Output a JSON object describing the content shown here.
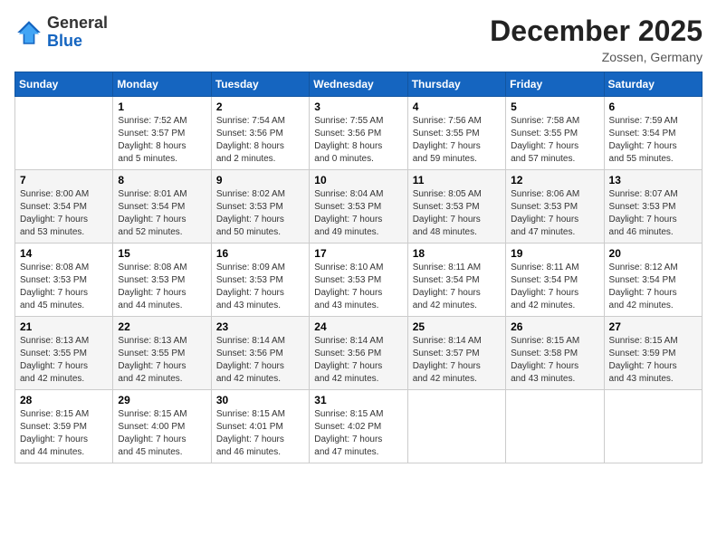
{
  "logo": {
    "general": "General",
    "blue": "Blue"
  },
  "header": {
    "month": "December 2025",
    "location": "Zossen, Germany"
  },
  "weekdays": [
    "Sunday",
    "Monday",
    "Tuesday",
    "Wednesday",
    "Thursday",
    "Friday",
    "Saturday"
  ],
  "weeks": [
    [
      {
        "day": "",
        "info": ""
      },
      {
        "day": "1",
        "info": "Sunrise: 7:52 AM\nSunset: 3:57 PM\nDaylight: 8 hours\nand 5 minutes."
      },
      {
        "day": "2",
        "info": "Sunrise: 7:54 AM\nSunset: 3:56 PM\nDaylight: 8 hours\nand 2 minutes."
      },
      {
        "day": "3",
        "info": "Sunrise: 7:55 AM\nSunset: 3:56 PM\nDaylight: 8 hours\nand 0 minutes."
      },
      {
        "day": "4",
        "info": "Sunrise: 7:56 AM\nSunset: 3:55 PM\nDaylight: 7 hours\nand 59 minutes."
      },
      {
        "day": "5",
        "info": "Sunrise: 7:58 AM\nSunset: 3:55 PM\nDaylight: 7 hours\nand 57 minutes."
      },
      {
        "day": "6",
        "info": "Sunrise: 7:59 AM\nSunset: 3:54 PM\nDaylight: 7 hours\nand 55 minutes."
      }
    ],
    [
      {
        "day": "7",
        "info": ""
      },
      {
        "day": "8",
        "info": "Sunrise: 8:01 AM\nSunset: 3:54 PM\nDaylight: 7 hours\nand 52 minutes."
      },
      {
        "day": "9",
        "info": "Sunrise: 8:02 AM\nSunset: 3:53 PM\nDaylight: 7 hours\nand 50 minutes."
      },
      {
        "day": "10",
        "info": "Sunrise: 8:04 AM\nSunset: 3:53 PM\nDaylight: 7 hours\nand 49 minutes."
      },
      {
        "day": "11",
        "info": "Sunrise: 8:05 AM\nSunset: 3:53 PM\nDaylight: 7 hours\nand 48 minutes."
      },
      {
        "day": "12",
        "info": "Sunrise: 8:06 AM\nSunset: 3:53 PM\nDaylight: 7 hours\nand 47 minutes."
      },
      {
        "day": "13",
        "info": "Sunrise: 8:07 AM\nSunset: 3:53 PM\nDaylight: 7 hours\nand 46 minutes."
      }
    ],
    [
      {
        "day": "14",
        "info": ""
      },
      {
        "day": "15",
        "info": "Sunrise: 8:08 AM\nSunset: 3:53 PM\nDaylight: 7 hours\nand 44 minutes."
      },
      {
        "day": "16",
        "info": "Sunrise: 8:09 AM\nSunset: 3:53 PM\nDaylight: 7 hours\nand 43 minutes."
      },
      {
        "day": "17",
        "info": "Sunrise: 8:10 AM\nSunset: 3:53 PM\nDaylight: 7 hours\nand 43 minutes."
      },
      {
        "day": "18",
        "info": "Sunrise: 8:11 AM\nSunset: 3:54 PM\nDaylight: 7 hours\nand 42 minutes."
      },
      {
        "day": "19",
        "info": "Sunrise: 8:11 AM\nSunset: 3:54 PM\nDaylight: 7 hours\nand 42 minutes."
      },
      {
        "day": "20",
        "info": "Sunrise: 8:12 AM\nSunset: 3:54 PM\nDaylight: 7 hours\nand 42 minutes."
      }
    ],
    [
      {
        "day": "21",
        "info": ""
      },
      {
        "day": "22",
        "info": "Sunrise: 8:13 AM\nSunset: 3:55 PM\nDaylight: 7 hours\nand 42 minutes."
      },
      {
        "day": "23",
        "info": "Sunrise: 8:14 AM\nSunset: 3:56 PM\nDaylight: 7 hours\nand 42 minutes."
      },
      {
        "day": "24",
        "info": "Sunrise: 8:14 AM\nSunset: 3:56 PM\nDaylight: 7 hours\nand 42 minutes."
      },
      {
        "day": "25",
        "info": "Sunrise: 8:14 AM\nSunset: 3:57 PM\nDaylight: 7 hours\nand 42 minutes."
      },
      {
        "day": "26",
        "info": "Sunrise: 8:15 AM\nSunset: 3:58 PM\nDaylight: 7 hours\nand 43 minutes."
      },
      {
        "day": "27",
        "info": "Sunrise: 8:15 AM\nSunset: 3:59 PM\nDaylight: 7 hours\nand 43 minutes."
      }
    ],
    [
      {
        "day": "28",
        "info": "Sunrise: 8:15 AM\nSunset: 3:59 PM\nDaylight: 7 hours\nand 44 minutes."
      },
      {
        "day": "29",
        "info": "Sunrise: 8:15 AM\nSunset: 4:00 PM\nDaylight: 7 hours\nand 45 minutes."
      },
      {
        "day": "30",
        "info": "Sunrise: 8:15 AM\nSunset: 4:01 PM\nDaylight: 7 hours\nand 46 minutes."
      },
      {
        "day": "31",
        "info": "Sunrise: 8:15 AM\nSunset: 4:02 PM\nDaylight: 7 hours\nand 47 minutes."
      },
      {
        "day": "",
        "info": ""
      },
      {
        "day": "",
        "info": ""
      },
      {
        "day": "",
        "info": ""
      }
    ]
  ],
  "week7_sunday": {
    "day": "7",
    "info": "Sunrise: 8:00 AM\nSunset: 3:54 PM\nDaylight: 7 hours\nand 53 minutes."
  },
  "week14_sunday": {
    "day": "14",
    "info": "Sunrise: 8:08 AM\nSunset: 3:53 PM\nDaylight: 7 hours\nand 45 minutes."
  },
  "week21_sunday": {
    "day": "21",
    "info": "Sunrise: 8:13 AM\nSunset: 3:55 PM\nDaylight: 7 hours\nand 42 minutes."
  }
}
